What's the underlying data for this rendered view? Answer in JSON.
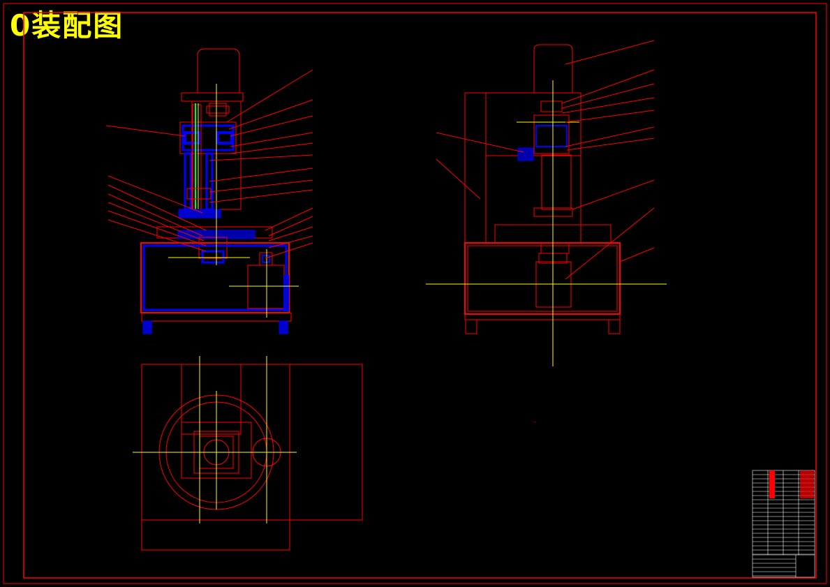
{
  "drawing": {
    "title": "0装配图",
    "colors": {
      "background": "#000000",
      "outline": "#ff0000",
      "centerline": "#ffff00",
      "section_hatch": "#0000ff",
      "shaft": "#00ff00",
      "title_text": "#ffff00"
    }
  },
  "views": [
    {
      "name": "front-section-view"
    },
    {
      "name": "side-view"
    },
    {
      "name": "top-view"
    }
  ],
  "title_block": {
    "name": "title-block-table"
  }
}
